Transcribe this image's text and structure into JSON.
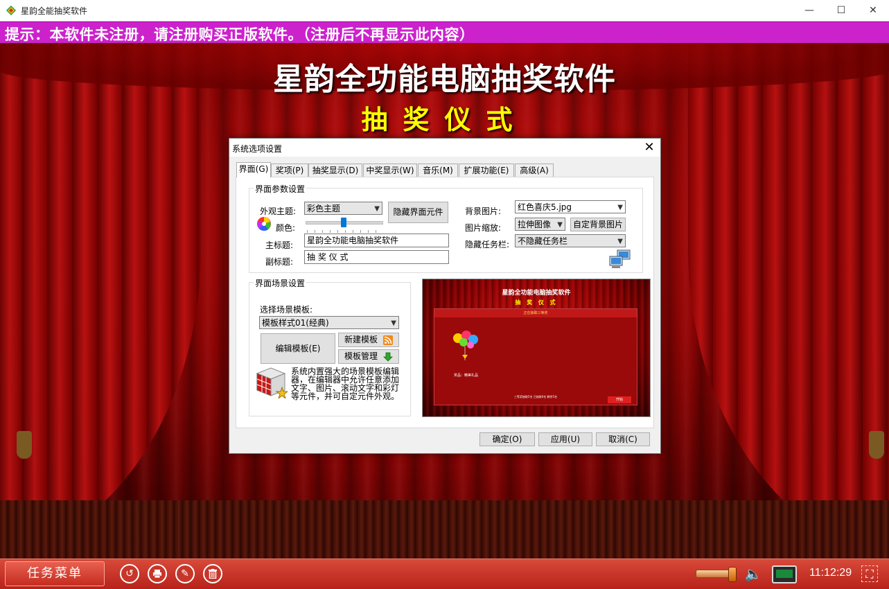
{
  "window": {
    "title": "星韵全能抽奖软件",
    "minimize": "—",
    "maximize": "☐",
    "close": "✕"
  },
  "notice": "提示：本软件未注册，请注册购买正版软件。（注册后不再显示此内容）",
  "stage": {
    "title": "星韵全功能电脑抽奖软件",
    "subtitle": "抽奖仪式"
  },
  "dialog": {
    "title": "系统选项设置",
    "close": "✕",
    "tabs": [
      {
        "label": "界面(G)"
      },
      {
        "label": "奖项(P)"
      },
      {
        "label": "抽奖显示(D)"
      },
      {
        "label": "中奖显示(W)"
      },
      {
        "label": "音乐(M)"
      },
      {
        "label": "扩展功能(E)"
      },
      {
        "label": "高级(A)"
      }
    ],
    "interface_group": {
      "legend": "界面参数设置",
      "theme_label": "外观主题:",
      "theme_value": "彩色主题",
      "color_label": "颜色:",
      "color_slider_level": 0.5,
      "hide_elements_button": "隐藏界面元件",
      "main_title_label": "主标题:",
      "main_title_value": "星韵全功能电脑抽奖软件",
      "sub_title_label": "副标题:",
      "sub_title_value": "抽 奖 仪 式",
      "bg_image_label": "背景图片:",
      "bg_image_value": "红色喜庆5.jpg",
      "image_scale_label": "图片缩放:",
      "image_scale_value": "拉伸图像",
      "custom_bg_button": "自定背景图片",
      "hide_taskbar_label": "隐藏任务栏:",
      "hide_taskbar_value": "不隐藏任务栏"
    },
    "scene_group": {
      "legend": "界面场景设置",
      "template_label": "选择场景模板:",
      "template_value": "模板样式01(经典)",
      "edit_template_button": "编辑模板(E)",
      "new_template_button": "新建模板",
      "manage_template_button": "模板管理",
      "description": "系统内置强大的场景模板编辑器，在编辑器中允许任意添加文字、图片、滚动文字和彩灯等元件，并可自定元件外观。"
    },
    "preview": {
      "title": "星韵全功能电脑抽奖软件",
      "subtitle": "抽 奖 仪 式",
      "bar": "正在抽取三等奖",
      "prize": "奖品：精美礼品",
      "footer": "三等奖抽取5名  已抽取0名  剩余5名",
      "button": "开始"
    },
    "buttons": {
      "ok": "确定(O)",
      "apply": "应用(U)",
      "cancel": "取消(C)"
    }
  },
  "taskbar": {
    "menu_label": "任务菜单",
    "clock": "11:12:29",
    "volume_level": 0.9
  },
  "colors": {
    "notice_bg": "#cc22cc",
    "stage_red": "#c81010",
    "subtitle_yellow": "#ffff00",
    "taskbar_red": "#c8362a",
    "accent_blue": "#0078d7"
  }
}
